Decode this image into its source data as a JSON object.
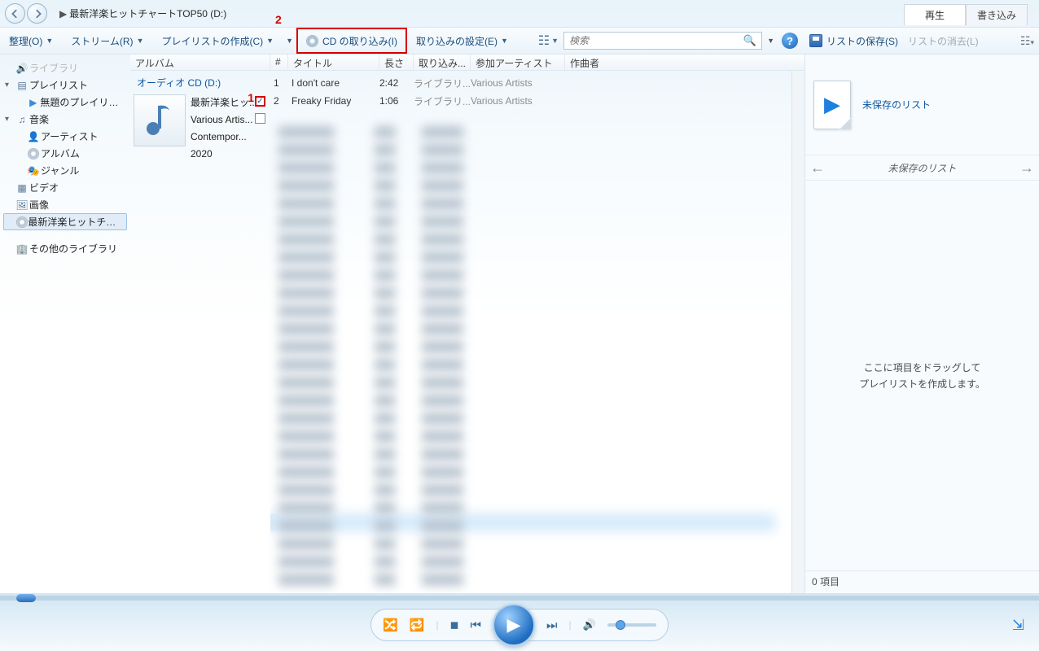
{
  "nav": {
    "breadcrumb": "最新洋楽ヒットチャートTOP50 (D:)"
  },
  "tabs": {
    "play": "再生",
    "burn": "書き込み"
  },
  "toolbar": {
    "organize": "整理(O)",
    "stream": "ストリーム(R)",
    "create_pl": "プレイリストの作成(C)",
    "rip": "CD の取り込み(I)",
    "rip_settings": "取り込みの設定(E)"
  },
  "search": {
    "placeholder": "検索"
  },
  "annotations": {
    "one": "1",
    "two": "2"
  },
  "sidebar": {
    "library": "ライブラリ",
    "playlist": "プレイリスト",
    "untitled_pl": "無題のプレイリスト",
    "music": "音楽",
    "artist": "アーティスト",
    "album": "アルバム",
    "genre": "ジャンル",
    "video": "ビデオ",
    "picture": "画像",
    "cd_drive": "最新洋楽ヒットチャートT",
    "other": "その他のライブラリ"
  },
  "columns": {
    "album": "アルバム",
    "num": "#",
    "title": "タイトル",
    "length": "長さ",
    "rip": "取り込み...",
    "artist": "参加アーティスト",
    "composer": "作曲者"
  },
  "cd": {
    "header": "オーディオ CD (D:)",
    "album_name": "最新洋楽ヒッ...",
    "album_artist": "Various Artis...",
    "genre": "Contempor...",
    "year": "2020"
  },
  "tracks": [
    {
      "num": "1",
      "title": "I don't care",
      "length": "2:42",
      "rip": "ライブラリ...",
      "artist": "Various Artists"
    },
    {
      "num": "2",
      "title": "Freaky Friday",
      "length": "1:06",
      "rip": "ライブラリ...",
      "artist": "Various Artists"
    }
  ],
  "right": {
    "save_list": "リストの保存(S)",
    "clear_list": "リストの消去(L)",
    "unsaved": "未保存のリスト",
    "unsaved2": "未保存のリスト",
    "drop1": "ここに項目をドラッグして",
    "drop2": "プレイリストを作成します。",
    "footer": "0 項目"
  }
}
